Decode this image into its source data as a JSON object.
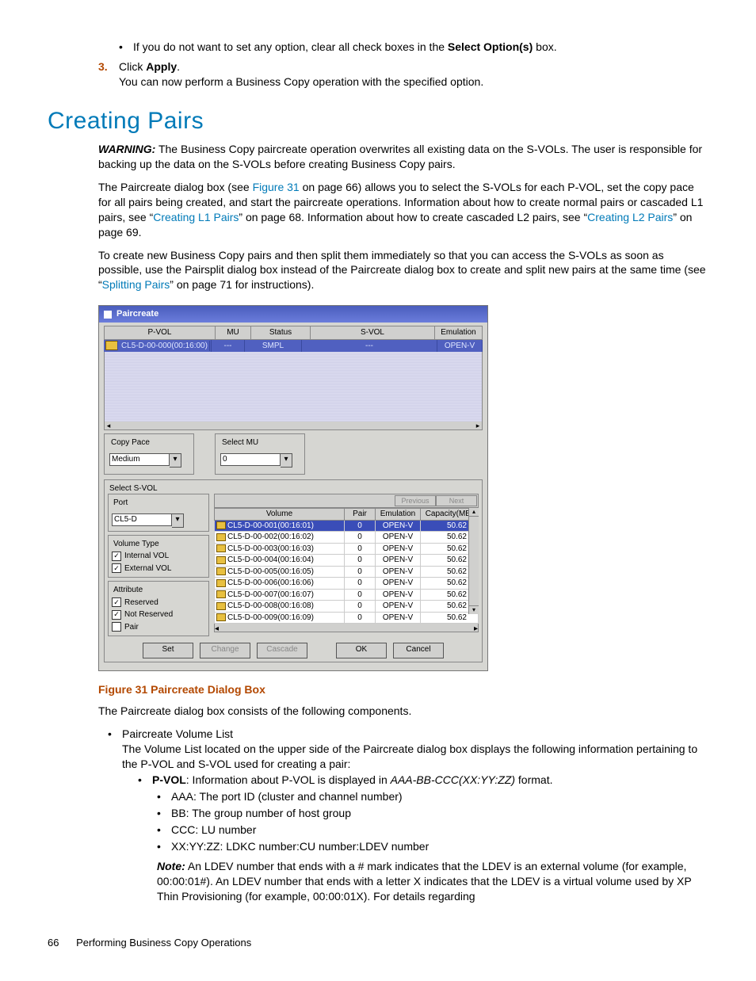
{
  "intro": {
    "bullet1_a": "If you do not want to set any option, clear all check boxes in the ",
    "bullet1_b": "Select Option(s)",
    "bullet1_c": " box.",
    "step3_num": "3.",
    "step3_a": "Click ",
    "step3_b": "Apply",
    "step3_c": ".",
    "step3_line2": "You can now perform a Business Copy operation with the specified option."
  },
  "heading": "Creating Pairs",
  "warn": {
    "label": "WARNING:",
    "text": " The Business Copy paircreate operation overwrites all existing data on the S-VOLs. The user is responsible for backing up the data on the S-VOLs before creating Business Copy pairs."
  },
  "p2": {
    "a": "The Paircreate dialog box (see ",
    "link1": "Figure 31",
    "b": " on page 66) allows you to select the S-VOLs for each P-VOL, set the copy pace for all pairs being created, and start the paircreate operations. Information about how to create normal pairs or cascaded L1 pairs, see “",
    "link2": "Creating L1 Pairs",
    "c": "” on page 68. Information about how to create cascaded L2 pairs, see “",
    "link3": "Creating L2 Pairs",
    "d": "” on page 69."
  },
  "p3": {
    "a": "To create new Business Copy pairs and then split them immediately so that you can access the S-VOLs as soon as possible, use the Pairsplit dialog box instead of the Paircreate dialog box to create and split new pairs at the same time (see “",
    "link": "Splitting Pairs",
    "b": "” on page 71 for instructions)."
  },
  "dialog": {
    "title": "Paircreate",
    "headers": {
      "pvol": "P-VOL",
      "mu": "MU",
      "status": "Status",
      "svol": "S-VOL",
      "emu": "Emulation"
    },
    "row": {
      "pvol": "CL5-D-00-000(00:16:00)",
      "mu": "---",
      "status": "SMPL",
      "svol": "---",
      "emu": "OPEN-V"
    },
    "copy_pace": {
      "label": "Copy Pace",
      "value": "Medium"
    },
    "select_mu": {
      "label": "Select MU",
      "value": "0"
    },
    "select_svol": "Select S-VOL",
    "port": {
      "label": "Port",
      "value": "CL5-D"
    },
    "volume_type": {
      "label": "Volume Type",
      "internal": "Internal VOL",
      "external": "External VOL"
    },
    "attribute": {
      "label": "Attribute",
      "reserved": "Reserved",
      "not_reserved": "Not Reserved",
      "pair": "Pair"
    },
    "nav": {
      "prev": "Previous",
      "next": "Next"
    },
    "svol_headers": {
      "volume": "Volume",
      "pair": "Pair",
      "emu": "Emulation",
      "cap": "Capacity(MB)"
    },
    "svol_rows": [
      {
        "vol": "CL5-D-00-001(00:16:01)",
        "pair": "0",
        "emu": "OPEN-V",
        "cap": "50.62"
      },
      {
        "vol": "CL5-D-00-002(00:16:02)",
        "pair": "0",
        "emu": "OPEN-V",
        "cap": "50.62"
      },
      {
        "vol": "CL5-D-00-003(00:16:03)",
        "pair": "0",
        "emu": "OPEN-V",
        "cap": "50.62"
      },
      {
        "vol": "CL5-D-00-004(00:16:04)",
        "pair": "0",
        "emu": "OPEN-V",
        "cap": "50.62"
      },
      {
        "vol": "CL5-D-00-005(00:16:05)",
        "pair": "0",
        "emu": "OPEN-V",
        "cap": "50.62"
      },
      {
        "vol": "CL5-D-00-006(00:16:06)",
        "pair": "0",
        "emu": "OPEN-V",
        "cap": "50.62"
      },
      {
        "vol": "CL5-D-00-007(00:16:07)",
        "pair": "0",
        "emu": "OPEN-V",
        "cap": "50.62"
      },
      {
        "vol": "CL5-D-00-008(00:16:08)",
        "pair": "0",
        "emu": "OPEN-V",
        "cap": "50.62"
      },
      {
        "vol": "CL5-D-00-009(00:16:09)",
        "pair": "0",
        "emu": "OPEN-V",
        "cap": "50.62"
      }
    ],
    "buttons": {
      "set": "Set",
      "change": "Change",
      "cascade": "Cascade",
      "ok": "OK",
      "cancel": "Cancel"
    }
  },
  "figcap": "Figure 31 Paircreate Dialog Box",
  "p4": "The Paircreate dialog box consists of the following components.",
  "comp": {
    "li1": "Paircreate Volume List",
    "li1_desc": "The Volume List located on the upper side of the Paircreate dialog box displays the following information pertaining to the P-VOL and S-VOL used for creating a pair:",
    "pvol_label": "P-VOL",
    "pvol_a": ": Information about P-VOL is displayed in ",
    "pvol_fmt": "AAA-BB-CCC(XX:YY:ZZ)",
    "pvol_b": " format.",
    "aaa": "AAA: The port ID (cluster and channel number)",
    "bb": "BB: The group number of host group",
    "ccc": "CCC: LU number",
    "xyz": "XX:YY:ZZ: LDKC number:CU number:LDEV number",
    "note_label": "Note:",
    "note_text": " An LDEV number that ends with a # mark indicates that the LDEV is an external volume (for example, 00:00:01#). An LDEV number that ends with a letter X indicates that the LDEV is a virtual volume used by XP Thin Provisioning (for example, 00:00:01X). For details regarding"
  },
  "footer": {
    "page": "66",
    "title": "Performing Business Copy Operations"
  }
}
